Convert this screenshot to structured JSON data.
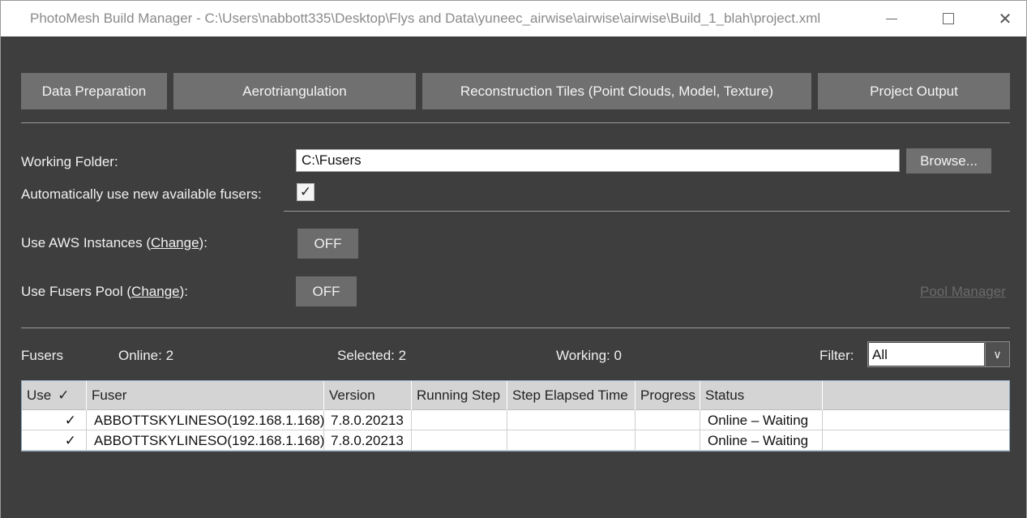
{
  "window": {
    "title": "PhotoMesh Build Manager - C:\\Users\\nabbott335\\Desktop\\Flys and Data\\yuneec_airwise\\airwise\\airwise\\Build_1_blah\\project.xml",
    "controls": {
      "minimize_icon": "minimize-icon",
      "maximize_icon": "maximize-icon",
      "close_glyph": "✕"
    }
  },
  "tabs": [
    {
      "label": "Data Preparation"
    },
    {
      "label": "Aerotriangulation"
    },
    {
      "label": "Reconstruction Tiles (Point Clouds, Model, Texture)"
    },
    {
      "label": "Project Output"
    }
  ],
  "settings": {
    "working_folder_label": "Working Folder:",
    "working_folder_value": "C:\\Fusers",
    "browse_label": "Browse...",
    "auto_use_label": "Automatically use new available fusers:",
    "auto_use_checked": true,
    "check_glyph": "✓",
    "aws_label_prefix": "Use AWS Instances (",
    "aws_change": "Change",
    "aws_label_suffix": "):",
    "aws_state": "OFF",
    "pool_label_prefix": "Use Fusers Pool (",
    "pool_change": "Change",
    "pool_label_suffix": "):",
    "pool_state": "OFF",
    "pool_manager_label": "Pool Manager"
  },
  "stats": {
    "fusers_label": "Fusers",
    "online": "Online: 2",
    "selected": "Selected: 2",
    "working": "Working: 0",
    "filter_label": "Filter:",
    "filter_value": "All",
    "filter_arrow": "∨"
  },
  "table": {
    "headers": {
      "use": "Use",
      "use_check": "✓",
      "fuser": "Fuser",
      "version": "Version",
      "running_step": "Running Step",
      "step_elapsed": "Step Elapsed Time",
      "progress": "Progress",
      "status": "Status"
    },
    "rows": [
      {
        "use": "✓",
        "fuser": "ABBOTTSKYLINESO(192.168.1.168)",
        "version": "7.8.0.20213",
        "running_step": "",
        "step_elapsed": "",
        "progress": "",
        "status": "Online – Waiting"
      },
      {
        "use": "✓",
        "fuser": "ABBOTTSKYLINESO(192.168.1.168)",
        "version": "7.8.0.20213",
        "running_step": "",
        "step_elapsed": "",
        "progress": "",
        "status": "Online – Waiting"
      }
    ]
  },
  "colors": {
    "background": "#3e3e3e",
    "button": "#707070",
    "text": "#f0f0f0"
  }
}
